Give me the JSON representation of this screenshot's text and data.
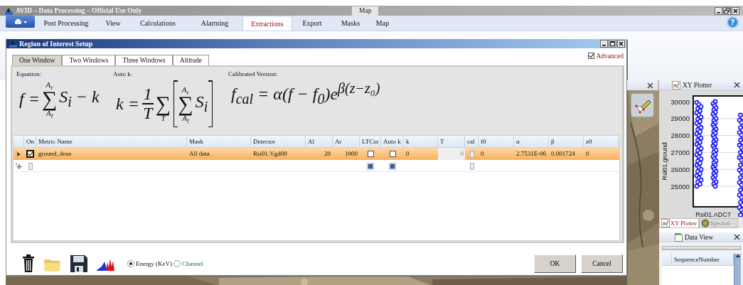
{
  "app": {
    "title": "AVID – Data Processing – Official Use Only",
    "title_tab": "Map",
    "help": "?"
  },
  "menu": {
    "items": [
      {
        "label": "Post Processing",
        "selected": false
      },
      {
        "label": "View",
        "selected": false
      },
      {
        "label": "Calculations",
        "selected": false
      },
      {
        "label": "Alarming",
        "selected": false
      },
      {
        "label": "Extractions",
        "selected": true
      },
      {
        "label": "Export",
        "selected": false
      },
      {
        "label": "Masks",
        "selected": false
      },
      {
        "label": "Map",
        "selected": false
      }
    ]
  },
  "dialog": {
    "title": "Region of Interest Setup",
    "tabs": [
      {
        "label": "One Window",
        "selected": true
      },
      {
        "label": "Two Windows",
        "selected": false
      },
      {
        "label": "Three Windows",
        "selected": false
      },
      {
        "label": "Altitude",
        "selected": false
      }
    ],
    "advanced": {
      "label": "Advanced",
      "checked": true
    },
    "formulas": [
      {
        "label": "Equation:",
        "parts": [
          {
            "kind": "text",
            "text": "f ="
          },
          {
            "kind": "sum",
            "symbol": "∑",
            "upper": "A$_{r}$",
            "lower": "A$_{l}$"
          },
          {
            "kind": "text",
            "text": "S$_{i}$ − k"
          }
        ]
      },
      {
        "label": "Auto k:",
        "parts": [
          {
            "kind": "text",
            "text": "k ="
          },
          {
            "kind": "frac",
            "num": "1",
            "den": "T"
          },
          {
            "kind": "sum",
            "symbol": "∑",
            "lower": "T"
          },
          {
            "kind": "bracket",
            "parts": [
              {
                "kind": "sum",
                "symbol": "∑",
                "upper": "A$_{r}$",
                "lower": "A$_{l}$"
              },
              {
                "kind": "text",
                "text": "S$_{i}$"
              }
            ]
          }
        ]
      },
      {
        "label": "Calibrated Version:",
        "parts": [
          {
            "kind": "text",
            "text": "f$_{cal}$ = α(f − f$_{0}$)e$^{β(z−z₀)}$"
          }
        ]
      }
    ],
    "table": {
      "columns": [
        {
          "label": "On",
          "kind": "check"
        },
        {
          "label": "Metric Name",
          "kind": "text"
        },
        {
          "label": "Mask",
          "kind": "text"
        },
        {
          "label": "Detector",
          "kind": "text"
        },
        {
          "label": "Al",
          "kind": "number"
        },
        {
          "label": "Ar",
          "kind": "number"
        },
        {
          "label": "LTCor",
          "kind": "check"
        },
        {
          "label": "Auto k",
          "kind": "check"
        },
        {
          "label": "k",
          "kind": "text"
        },
        {
          "label": "T",
          "kind": "disabled_number"
        },
        {
          "label": "cal",
          "kind": "button"
        },
        {
          "label": "f0",
          "kind": "text"
        },
        {
          "label": "α",
          "kind": "text"
        },
        {
          "label": "β",
          "kind": "text"
        },
        {
          "label": "z0",
          "kind": "text"
        }
      ],
      "rows": [
        {
          "kind": "data",
          "selected": true,
          "values": [
            true,
            "ground_dose",
            "All data",
            "Rsi01.Vgd00",
            "20",
            "1000",
            false,
            false,
            "0",
            "0",
            "0",
            "2.7531E-06",
            "0.001724",
            "0"
          ]
        },
        {
          "kind": "new",
          "selected": false
        }
      ]
    },
    "units": [
      {
        "label": "Energy (KeV)",
        "selected": true
      },
      {
        "label": "Channel",
        "selected": false
      }
    ],
    "buttons": [
      "OK",
      "Cancel"
    ]
  },
  "xy_plotter": {
    "title": "XY Plotter",
    "yticks": [
      "30000",
      "29000",
      "28000",
      "27000",
      "26000",
      "25000"
    ],
    "ylabel": "Rsi01.ground",
    "xlabel": "Rsi01.ADC7"
  },
  "panel_tabs": [
    {
      "label": "XY Plotter",
      "selected": true
    },
    {
      "label": "Spectral···",
      "selected": false
    }
  ],
  "data_view": {
    "title": "Data View",
    "columns": [
      "SequenceNumber"
    ]
  }
}
